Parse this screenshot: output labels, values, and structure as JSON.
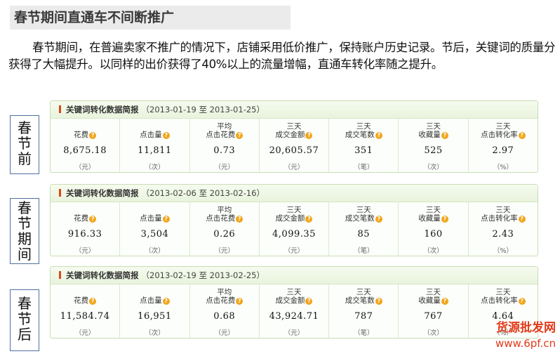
{
  "title": "春节期间直通车不间断推广",
  "paragraph": "春节期间，在普遍卖家不推广的情况下，店铺采用低价推广，保持账户历史记录。节后，关键词的质量分获得了大幅提升。以同样的出价获得了40%以上的流量增幅，直通车转化率随之提升。",
  "panels": [
    {
      "side_label": "春节前",
      "header": "关键词转化数据简报",
      "range": "（2013-01-19 至 2013-01-25）",
      "metrics": [
        {
          "l1": "",
          "l2": "花费",
          "value": "8,675.18",
          "unit": "（元）"
        },
        {
          "l1": "",
          "l2": "点击量",
          "value": "11,811",
          "unit": "（次）"
        },
        {
          "l1": "平均",
          "l2": "点击花费",
          "value": "0.73",
          "unit": "（元）"
        },
        {
          "l1": "三天",
          "l2": "成交金额",
          "value": "20,605.57",
          "unit": "（元）"
        },
        {
          "l1": "三天",
          "l2": "成交笔数",
          "value": "351",
          "unit": "（笔）"
        },
        {
          "l1": "三天",
          "l2": "收藏量",
          "value": "525",
          "unit": "（次）"
        },
        {
          "l1": "三天",
          "l2": "点击转化率",
          "value": "2.97",
          "unit": "（%）"
        }
      ]
    },
    {
      "side_label": "春节期间",
      "header": "关键词转化数据简报",
      "range": "（2013-02-06 至 2013-02-16）",
      "metrics": [
        {
          "l1": "",
          "l2": "花费",
          "value": "916.33",
          "unit": "（元）"
        },
        {
          "l1": "",
          "l2": "点击量",
          "value": "3,504",
          "unit": "（次）"
        },
        {
          "l1": "平均",
          "l2": "点击花费",
          "value": "0.26",
          "unit": "（元）"
        },
        {
          "l1": "三天",
          "l2": "成交金额",
          "value": "4,099.35",
          "unit": "（元）"
        },
        {
          "l1": "三天",
          "l2": "成交笔数",
          "value": "85",
          "unit": "（笔）"
        },
        {
          "l1": "三天",
          "l2": "收藏量",
          "value": "160",
          "unit": "（次）"
        },
        {
          "l1": "三天",
          "l2": "点击转化率",
          "value": "2.43",
          "unit": "（%）"
        }
      ]
    },
    {
      "side_label": "春节后",
      "header": "关键词转化数据简报",
      "range": "（2013-02-19 至 2013-02-25）",
      "metrics": [
        {
          "l1": "",
          "l2": "花费",
          "value": "11,584.74",
          "unit": "（元）"
        },
        {
          "l1": "",
          "l2": "点击量",
          "value": "16,951",
          "unit": "（次）"
        },
        {
          "l1": "平均",
          "l2": "点击花费",
          "value": "0.68",
          "unit": "（元）"
        },
        {
          "l1": "三天",
          "l2": "成交金额",
          "value": "43,924.71",
          "unit": "（元）"
        },
        {
          "l1": "三天",
          "l2": "成交笔数",
          "value": "787",
          "unit": "（笔）"
        },
        {
          "l1": "三天",
          "l2": "收藏量",
          "value": "767",
          "unit": "（次）"
        },
        {
          "l1": "三天",
          "l2": "点击转化率",
          "value": "4.64",
          "unit": "（%）"
        }
      ]
    }
  ],
  "watermark": {
    "brand": "货源批发网",
    "url": "www.6pf.cn"
  },
  "help_icon": "?"
}
